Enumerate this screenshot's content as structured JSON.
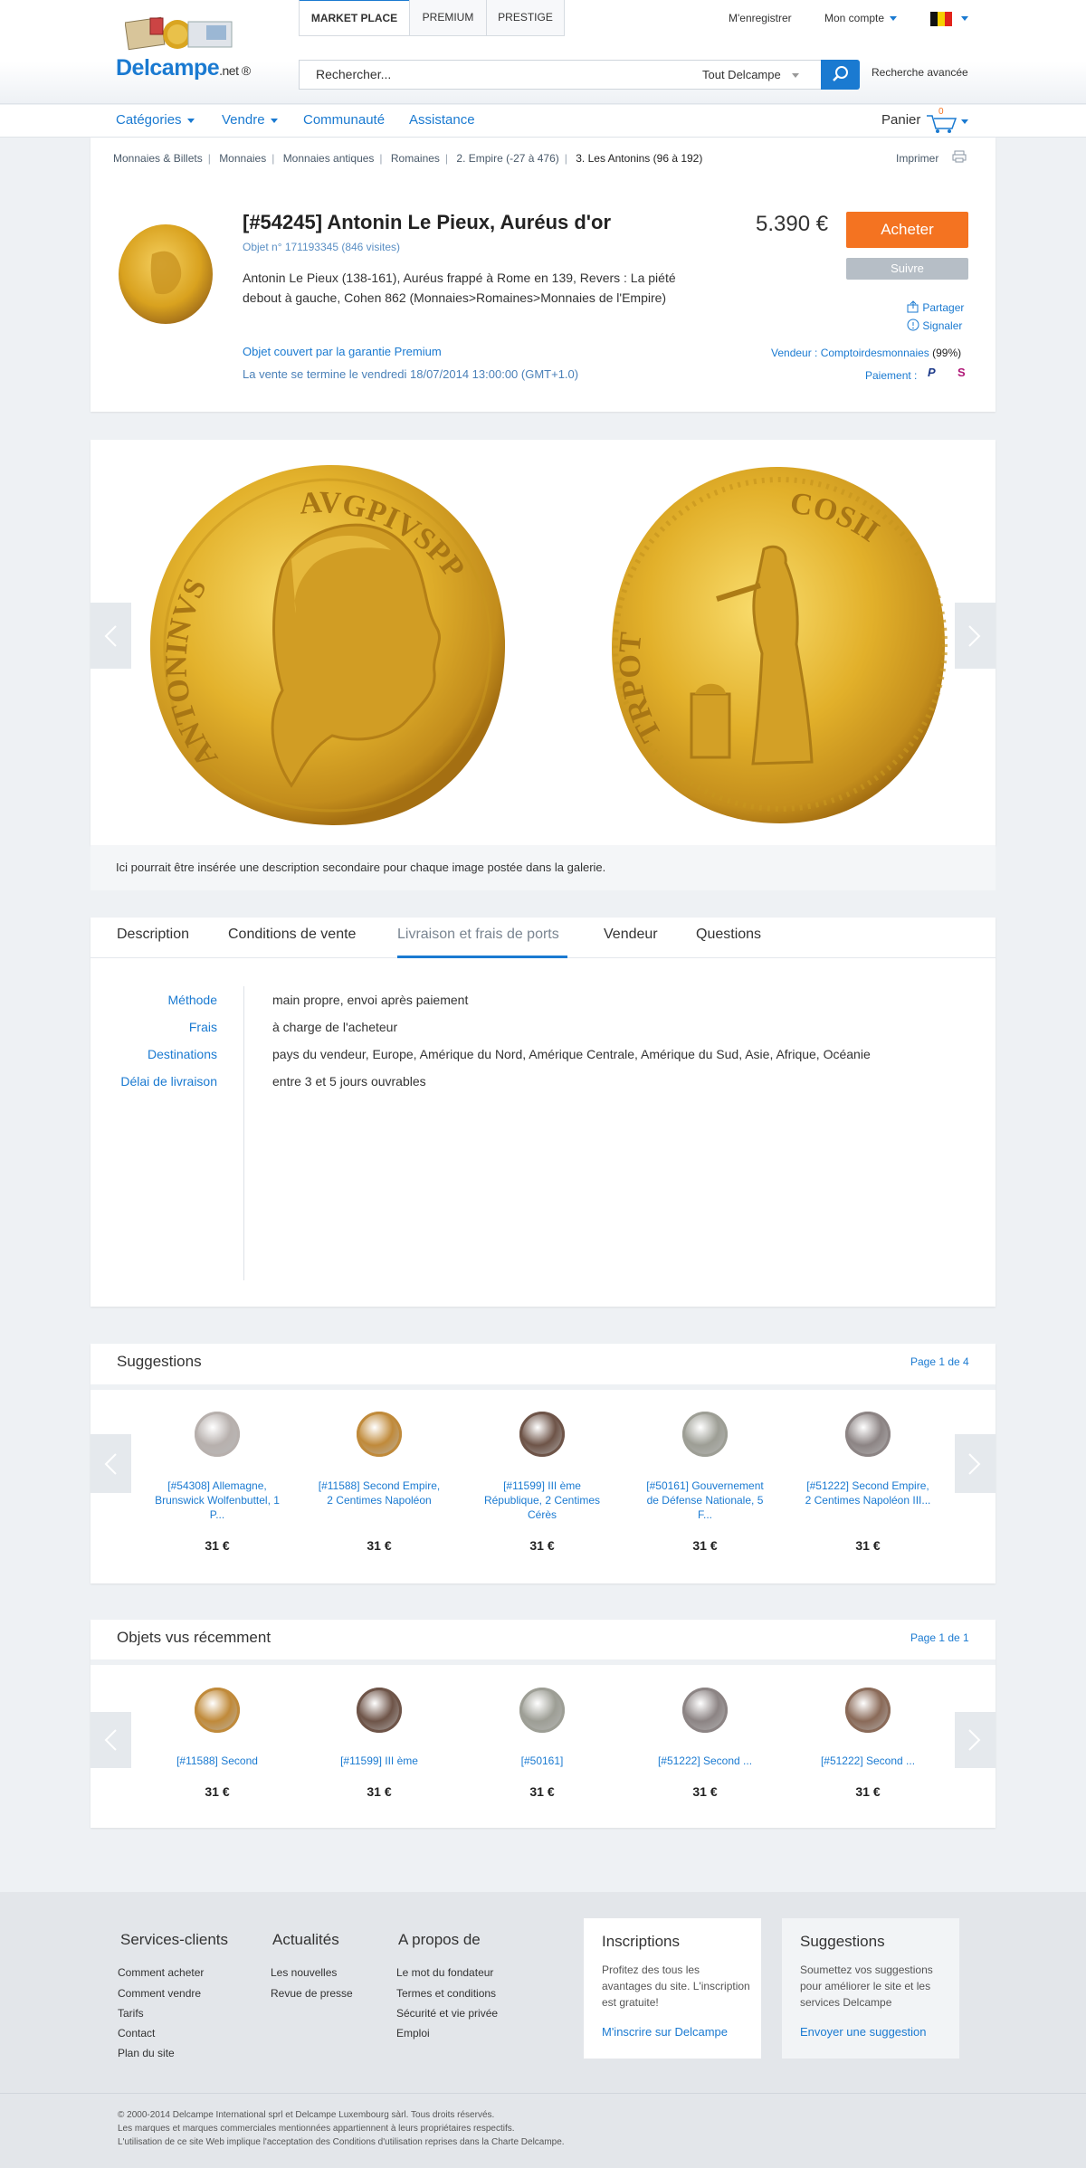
{
  "header": {
    "logo_text": "Delcampe",
    "logo_suffix": ".net",
    "logo_reg": "®",
    "tabs": [
      "MARKET PLACE",
      "PREMIUM",
      "PRESTIGE"
    ],
    "register": "M'enregistrer",
    "account": "Mon compte",
    "search_placeholder": "Rechercher...",
    "search_scope": "Tout Delcampe",
    "advanced_search": "Recherche avancée"
  },
  "nav": {
    "items": [
      "Catégories",
      "Vendre",
      "Communauté",
      "Assistance"
    ],
    "cart_label": "Panier",
    "cart_count": "0"
  },
  "breadcrumb": [
    "Monnaies & Billets",
    "Monnaies",
    "Monnaies antiques",
    "Romaines",
    "2. Empire (-27 à 476)",
    "3. Les Antonins (96 à 192)"
  ],
  "print_label": "Imprimer",
  "item": {
    "title": "[#54245] Antonin Le Pieux, Auréus d'or",
    "object_no": "Objet n° 171193345 (846 visites)",
    "description": "Antonin Le Pieux (138-161), Auréus frappé à Rome en 139, Revers : La piété debout à gauche, Cohen 862 (Monnaies>Romaines>Monnaies de l'Empire)",
    "guarantee": "Objet couvert par la garantie Premium",
    "end_date": "La vente se termine le vendredi 18/07/2014 13:00:00 (GMT+1.0)",
    "price": "5.390 €",
    "buy_label": "Acheter",
    "follow_label": "Suivre",
    "share_label": "Partager",
    "report_label": "Signaler",
    "seller_label": "Vendeur :",
    "seller_name": "Comptoirdesmonnaies",
    "seller_rating": "(99%)",
    "payment_label": "Paiement :"
  },
  "gallery": {
    "caption": "Ici pourrait être insérée une description secondaire pour chaque image postée dans la galerie.",
    "obverse_legend_left": "ANTONINVS",
    "obverse_legend_right": "AVGPIVSPP",
    "reverse_legend_left": "TRPOT",
    "reverse_legend_right": "COSII"
  },
  "tabs": [
    "Description",
    "Conditions de vente",
    "Livraison et frais de ports",
    "Vendeur",
    "Questions"
  ],
  "shipping": [
    {
      "label": "Méthode",
      "value": "main propre, envoi après paiement"
    },
    {
      "label": "Frais",
      "value": "à charge de l'acheteur"
    },
    {
      "label": "Destinations",
      "value": "pays du vendeur, Europe, Amérique du Nord, Amérique Centrale, Amérique du Sud, Asie, Afrique, Océanie"
    },
    {
      "label": "Délai de livraison",
      "value": "entre 3 et 5 jours ouvrables"
    }
  ],
  "suggestions": {
    "title": "Suggestions",
    "page": "Page 1 de 4",
    "items": [
      {
        "name": "[#54308] Allemagne, Brunswick Wolfenbuttel, 1 P...",
        "price": "31 €",
        "color": "#b7b0ad"
      },
      {
        "name": "[#11588] Second Empire, 2 Centimes Napoléon",
        "price": "31 €",
        "color": "#c08a3a"
      },
      {
        "name": "[#11599] III ème République, 2 Centimes Cérès",
        "price": "31 €",
        "color": "#6e5448"
      },
      {
        "name": "[#50161] Gouvernement de Défense Nationale, 5 F...",
        "price": "31 €",
        "color": "#9d9e95"
      },
      {
        "name": "[#51222] Second Empire, 2 Centimes Napoléon III...",
        "price": "31 €",
        "color": "#8c8484"
      }
    ]
  },
  "recent": {
    "title": "Objets vus récemment",
    "page": "Page 1 de 1",
    "items": [
      {
        "name": "[#11588] Second",
        "price": "31 €",
        "color": "#c08a3a"
      },
      {
        "name": "[#11599] III ème",
        "price": "31 €",
        "color": "#6e5448"
      },
      {
        "name": "[#50161]",
        "price": "31 €",
        "color": "#9d9e95"
      },
      {
        "name": "[#51222] Second ...",
        "price": "31 €",
        "color": "#8c8484"
      },
      {
        "name": "[#51222] Second ...",
        "price": "31 €",
        "color": "#8a6a58"
      }
    ]
  },
  "footer": {
    "columns": [
      {
        "title": "Services-clients",
        "links": [
          "Comment acheter",
          "Comment vendre",
          "Tarifs",
          "Contact",
          "Plan du site"
        ]
      },
      {
        "title": "Actualités",
        "links": [
          "Les nouvelles",
          "Revue de presse"
        ]
      },
      {
        "title": "A propos de",
        "links": [
          "Le mot du fondateur",
          "Termes et conditions",
          "Sécurité et vie privée",
          "Emploi"
        ]
      }
    ],
    "signup": {
      "title": "Inscriptions",
      "text": "Profitez des tous les avantages du site. L'inscription est gratuite!",
      "link": "M'inscrire sur Delcampe"
    },
    "suggest": {
      "title": "Suggestions",
      "text": "Soumettez vos suggestions pour améliorer le site et les services Delcampe",
      "link": "Envoyer une suggestion"
    },
    "copyright": [
      "© 2000-2014 Delcampe International sprl et Delcampe Luxembourg sàrl. Tous droits réservés.",
      "Les marques et marques commerciales mentionnées appartiennent à leurs propriétaires respectifs.",
      "L'utilisation de ce site Web implique l'acceptation des Conditions d'utilisation reprises dans la Charte Delcampe."
    ]
  },
  "colors": {
    "accent": "#1a7ad1",
    "buy": "#f47321",
    "gold": "#d9a520"
  }
}
